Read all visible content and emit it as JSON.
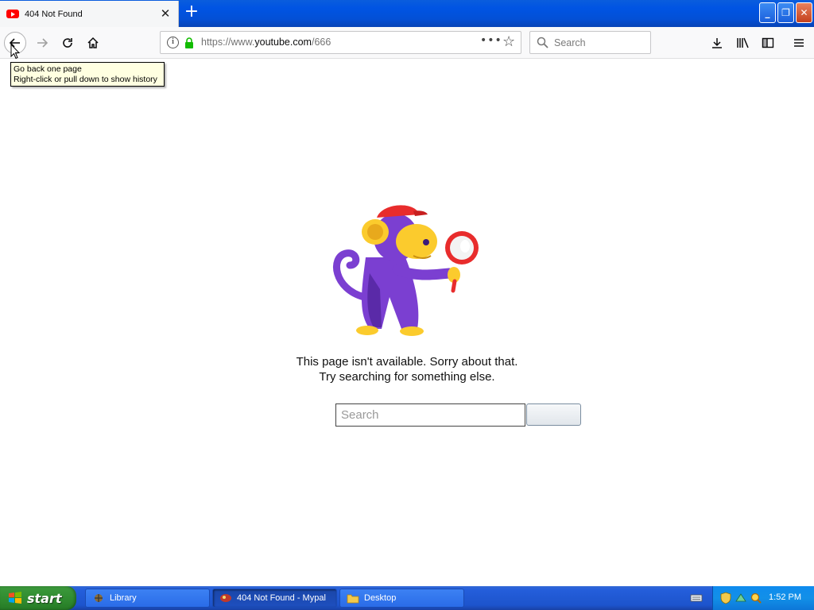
{
  "browser": {
    "tab": {
      "title": "404 Not Found",
      "favicon": "youtube-favicon-icon",
      "close_glyph": "✕"
    },
    "new_tab_glyph": "+",
    "window_controls": {
      "minimize": "_",
      "maximize": "❐",
      "close": "✕"
    },
    "url": {
      "prefix": "https://www.",
      "domain": "youtube.com",
      "path": "/666"
    },
    "page_actions_glyph": "•••",
    "search_placeholder": "Search",
    "tooltip": {
      "line1": "Go back one page",
      "line2": "Right-click or pull down to show history"
    }
  },
  "page": {
    "message_line1": "This page isn't available. Sorry about that.",
    "message_line2": "Try searching for something else.",
    "search_placeholder": "Search",
    "search_button_label": ""
  },
  "taskbar": {
    "start_label": "start",
    "items": [
      {
        "label": "Library",
        "icon": "library-icon"
      },
      {
        "label": "404 Not Found - Mypal",
        "icon": "mypal-icon"
      },
      {
        "label": "Desktop",
        "icon": "folder-icon"
      }
    ],
    "clock": "1:52 PM"
  },
  "colors": {
    "accent_blue": "#0054e3",
    "youtube_red": "#ff0000",
    "monkey_purple": "#7b3fd1",
    "monkey_yellow": "#fbcb2d",
    "lock_green": "#12bc00"
  }
}
